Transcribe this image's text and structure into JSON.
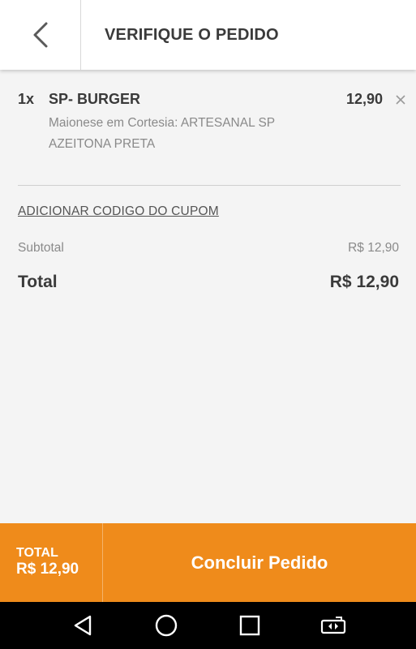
{
  "header": {
    "title": "VERIFIQUE O PEDIDO",
    "back_icon": "chevron-left-icon"
  },
  "order": {
    "items": [
      {
        "qty": "1x",
        "name": "SP- BURGER",
        "price": "12,90",
        "description": "Maionese em Cortesia: ARTESANAL SP AZEITONA PRETA"
      }
    ]
  },
  "coupon": {
    "link_label": "ADICIONAR CODIGO DO CUPOM"
  },
  "summary": {
    "subtotal_label": "Subtotal",
    "subtotal_value": "R$ 12,90",
    "total_label": "Total",
    "total_value": "R$ 12,90"
  },
  "checkout": {
    "total_label": "TOTAL",
    "total_value": "R$ 12,90",
    "button_label": "Concluir Pedido",
    "accent_color": "#ef8b1b"
  },
  "system_nav": {
    "icons": [
      "back-triangle-icon",
      "home-circle-icon",
      "recents-square-icon",
      "screen-rotate-icon"
    ]
  }
}
